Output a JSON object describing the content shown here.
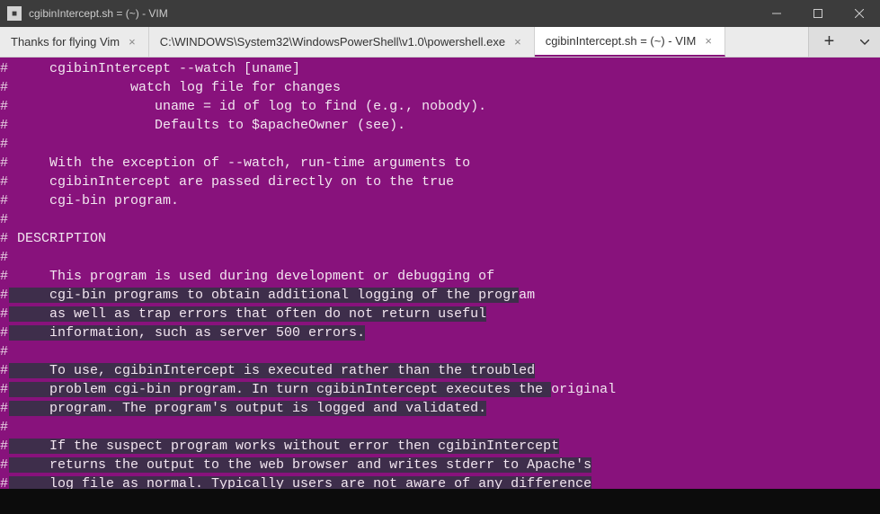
{
  "window": {
    "title": "cgibinIntercept.sh = (~) - VIM"
  },
  "tabs": [
    {
      "label": "Thanks for flying Vim",
      "active": false
    },
    {
      "label": "C:\\WINDOWS\\System32\\WindowsPowerShell\\v1.0\\powershell.exe",
      "active": false
    },
    {
      "label": "cgibinIntercept.sh = (~) - VIM",
      "active": true
    }
  ],
  "lines": [
    {
      "h": "#",
      "t": "     cgibinIntercept --watch [uname]",
      "sel": false
    },
    {
      "h": "#",
      "t": "               watch log file for changes",
      "sel": false
    },
    {
      "h": "#",
      "t": "                  uname = id of log to find (e.g., nobody).",
      "sel": false
    },
    {
      "h": "#",
      "t": "                  Defaults to $apacheOwner (see).",
      "sel": false
    },
    {
      "h": "#",
      "t": "",
      "sel": false
    },
    {
      "h": "#",
      "t": "     With the exception of --watch, run-time arguments to",
      "sel": false
    },
    {
      "h": "#",
      "t": "     cgibinIntercept are passed directly on to the true",
      "sel": false
    },
    {
      "h": "#",
      "t": "     cgi-bin program.",
      "sel": false
    },
    {
      "h": "#",
      "t": "",
      "sel": false
    },
    {
      "h": "#",
      "t": " DESCRIPTION",
      "sel": false
    },
    {
      "h": "#",
      "t": "",
      "sel": false
    },
    {
      "h": "#",
      "t": "     This program is used during development or debugging of",
      "sel": false
    },
    {
      "h": "#",
      "t": "     cgi-bin programs to obtain additional logging of the progr",
      "t2": "am",
      "sel": true
    },
    {
      "h": "#",
      "t": "     as well as trap errors that often do not return useful",
      "sel": true
    },
    {
      "h": "#",
      "t": "     information, such as server 500 errors.",
      "sel": true
    },
    {
      "h": "#",
      "t": "",
      "sel": true
    },
    {
      "h": "#",
      "t": "     To use, cgibinIntercept is executed rather than the troubled",
      "sel": true
    },
    {
      "h": "#",
      "t": "     problem cgi-bin program. In turn cgibinIntercept executes the ",
      "t2": "original",
      "sel": true
    },
    {
      "h": "#",
      "t": "     program. The program's output is logged and validated.",
      "sel": true
    },
    {
      "h": "#",
      "t": "",
      "sel": true
    },
    {
      "h": "#",
      "t": "     If the suspect program works without error then cgibinIntercept",
      "sel": true
    },
    {
      "h": "#",
      "t": "     returns the output to the web browser and writes stderr to Apache's",
      "sel": true
    },
    {
      "h": "#",
      "t": "     log file as normal. Typically users are not aware of any difference",
      "sel": true
    }
  ]
}
